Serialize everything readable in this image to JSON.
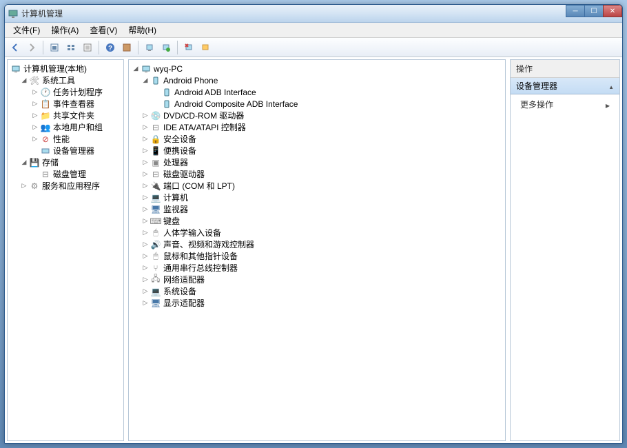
{
  "window": {
    "title": "计算机管理"
  },
  "menubar": {
    "file": "文件(F)",
    "action": "操作(A)",
    "view": "查看(V)",
    "help": "帮助(H)"
  },
  "toolbar": {
    "back": "back",
    "forward": "forward",
    "up": "up",
    "views": "views",
    "help": "help",
    "refresh": "refresh",
    "export": "export"
  },
  "left_tree": {
    "root": "计算机管理(本地)",
    "system_tools": "系统工具",
    "task_scheduler": "任务计划程序",
    "event_viewer": "事件查看器",
    "shared_folders": "共享文件夹",
    "local_users": "本地用户和组",
    "performance": "性能",
    "device_manager": "设备管理器",
    "storage": "存储",
    "disk_management": "磁盘管理",
    "services": "服务和应用程序"
  },
  "center_tree": {
    "root": "wyq-PC",
    "android_phone": "Android Phone",
    "android_adb": "Android ADB Interface",
    "android_comp": "Android Composite ADB Interface",
    "dvd": "DVD/CD-ROM 驱动器",
    "ide": "IDE ATA/ATAPI 控制器",
    "security": "安全设备",
    "portable": "便携设备",
    "processor": "处理器",
    "disk_drive": "磁盘驱动器",
    "ports": "端口 (COM 和 LPT)",
    "computer": "计算机",
    "monitor": "监视器",
    "keyboard": "键盘",
    "hid": "人体学输入设备",
    "audio": "声音、视频和游戏控制器",
    "mouse": "鼠标和其他指针设备",
    "usb": "通用串行总线控制器",
    "network": "网络适配器",
    "system": "系统设备",
    "display": "显示适配器"
  },
  "right_panel": {
    "header": "操作",
    "section": "设备管理器",
    "more_actions": "更多操作"
  }
}
